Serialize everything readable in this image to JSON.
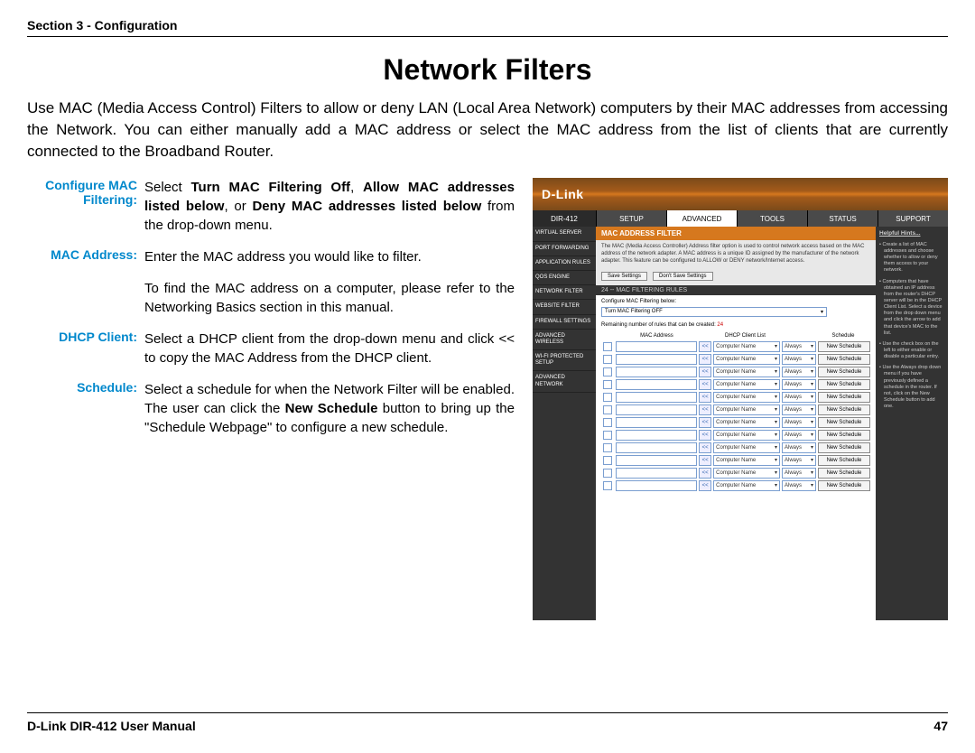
{
  "header": {
    "section": "Section 3 - Configuration"
  },
  "title": "Network Filters",
  "intro": "Use MAC (Media Access Control) Filters to allow or deny LAN (Local Area Network) computers by their MAC addresses from accessing the Network. You can either manually add a MAC address or select the MAC address from the list of clients that are currently connected to the Broadband Router.",
  "defs": {
    "cfg_label": "Configure MAC Filtering:",
    "cfg_pre": "Select ",
    "cfg_b1": "Turn MAC Filtering Off",
    "cfg_mid1": ", ",
    "cfg_b2": "Allow MAC addresses listed below",
    "cfg_mid2": ", or ",
    "cfg_b3": "Deny MAC addresses listed below",
    "cfg_post": " from the drop-down menu.",
    "mac_label": "MAC Address:",
    "mac_l1": "Enter the MAC address you would like to filter.",
    "mac_l2": "To find the MAC address on a computer, please refer to the Networking Basics section in this manual.",
    "dhcp_label": "DHCP Client:",
    "dhcp_body": "Select a DHCP client from the drop-down menu and click << to copy the MAC Address from the DHCP client.",
    "sched_label": "Schedule:",
    "sched_pre": "Select a schedule for when the Network Filter will be enabled. The user can click the ",
    "sched_b": "New Schedule",
    "sched_post": " button to bring up the \"Schedule Webpage\" to configure a new schedule."
  },
  "screenshot": {
    "brand": "D-Link",
    "model": "DIR-412",
    "nav": [
      "SETUP",
      "ADVANCED",
      "TOOLS",
      "STATUS",
      "SUPPORT"
    ],
    "nav_active": "ADVANCED",
    "sidebar": [
      "VIRTUAL SERVER",
      "PORT FORWARDING",
      "APPLICATION RULES",
      "QOS ENGINE",
      "NETWORK FILTER",
      "WEBSITE FILTER",
      "FIREWALL SETTINGS",
      "ADVANCED WIRELESS",
      "WI-FI PROTECTED SETUP",
      "ADVANCED NETWORK"
    ],
    "panel_title": "MAC ADDRESS FILTER",
    "panel_desc": "The MAC (Media Access Controller) Address filter option is used to control network access based on the MAC address of the network adapter. A MAC address is a unique ID assigned by the manufacturer of the network adapter. This feature can be configured to ALLOW or DENY network/Internet access.",
    "btn_save": "Save Settings",
    "btn_dont": "Don't Save Settings",
    "rules_title": "24 -- MAC FILTERING RULES",
    "cfg_below": "Configure MAC Filtering below:",
    "cfg_select": "Turn MAC Filtering OFF",
    "remaining_pre": "Remaining number of rules that can be created: ",
    "remaining_num": "24",
    "col_mac": "MAC Address",
    "col_dhcp": "DHCP Client List",
    "col_sched": "Schedule",
    "row_dhcp": "Computer Name",
    "row_sched": "Always",
    "row_newsched": "New Schedule",
    "row_count": 12,
    "hints_title": "Helpful Hints...",
    "hints": [
      "Create a list of MAC addresses and choose whether to allow or deny them access to your network.",
      "Computers that have obtained an IP address from the router's DHCP server will be in the DHCP Client List. Select a device from the drop down menu and click the arrow to add that device's MAC to the list.",
      "Use the check box on the left to either enable or disable a particular entry.",
      "Use the Always drop down menu if you have previously defined a schedule in the router. If not, click on the New Schedule button to add one."
    ]
  },
  "footer": {
    "manual": "D-Link DIR-412 User Manual",
    "page": "47"
  }
}
